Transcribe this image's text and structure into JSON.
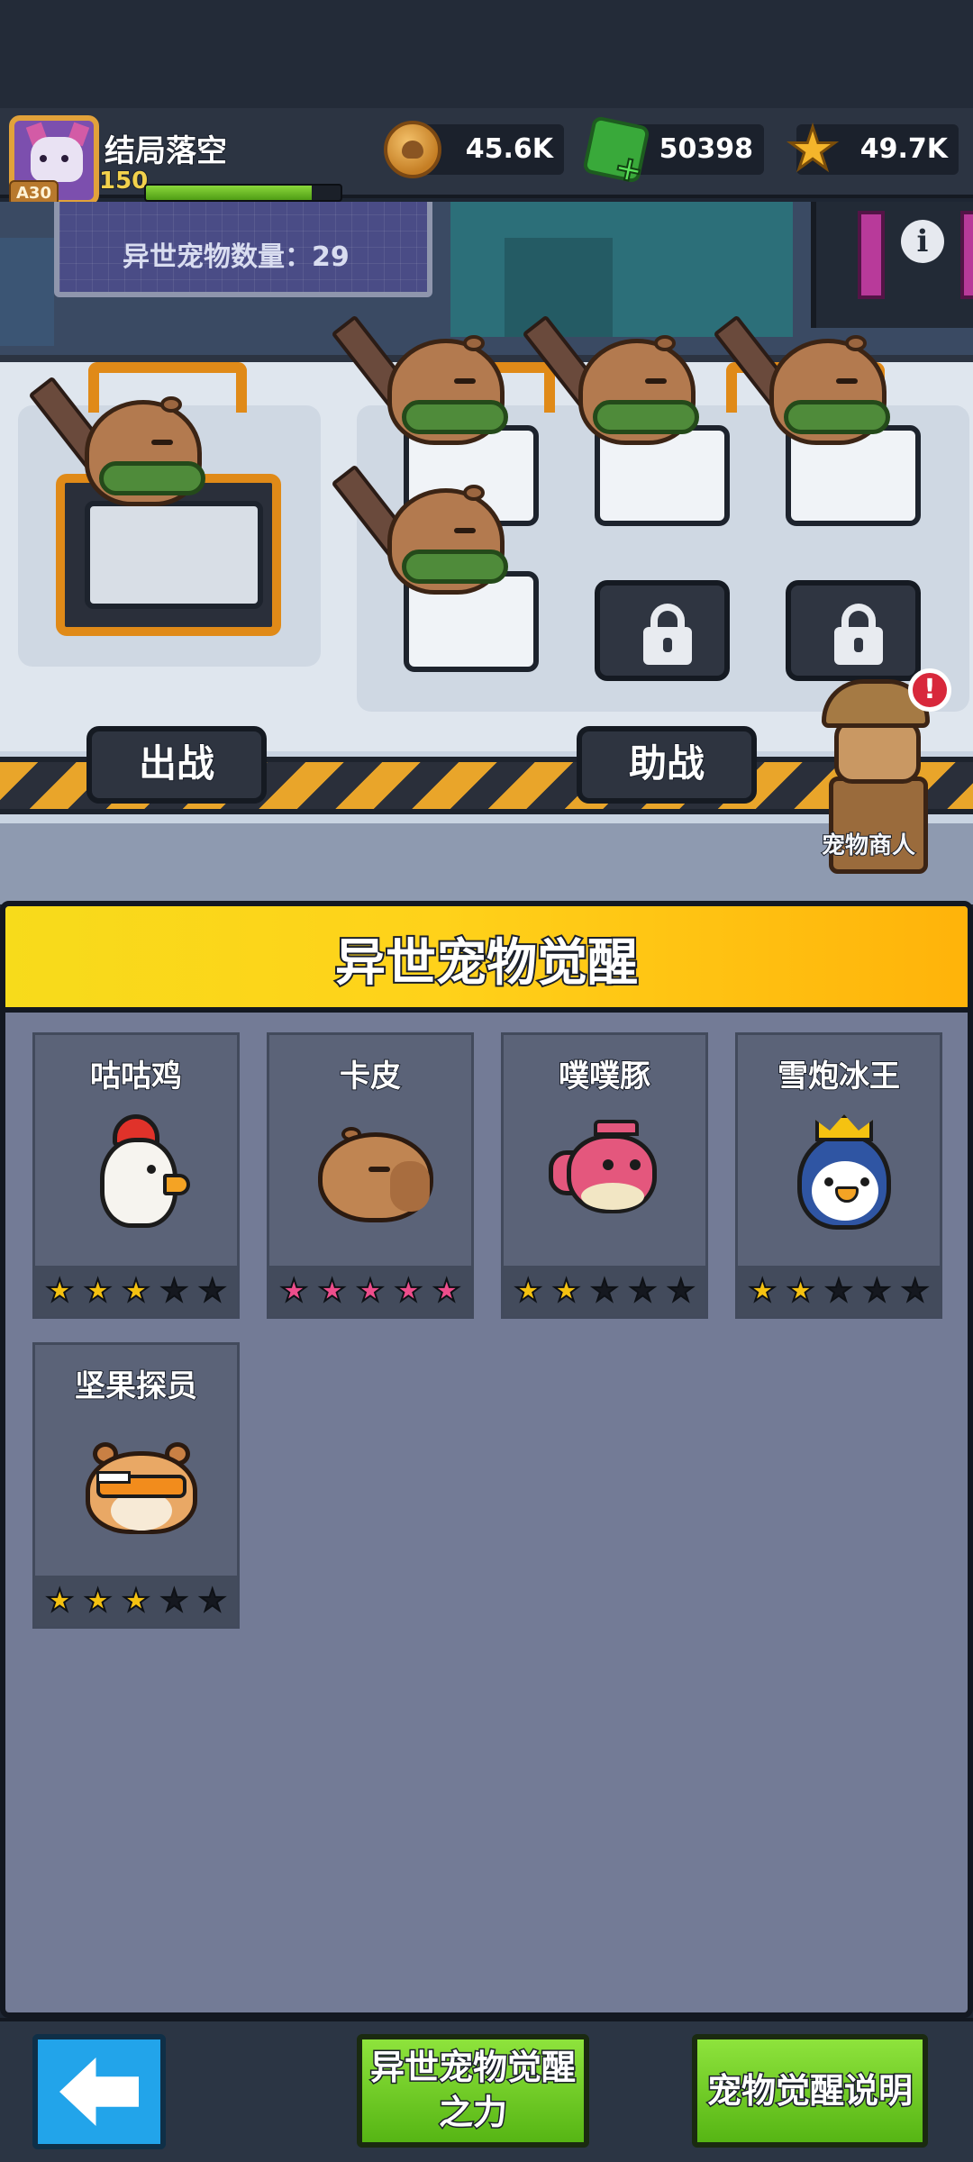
{
  "player": {
    "name": "结局落空",
    "level_badge": "A30",
    "power": "150",
    "xp_fraction": 0.85
  },
  "currencies": {
    "coin": {
      "icon": "coin-icon",
      "value": "45.6K"
    },
    "gem": {
      "icon": "gem-plus-icon",
      "value": "50398"
    },
    "star": {
      "icon": "star-icon",
      "value": "49.7K"
    }
  },
  "scene": {
    "pet_count_label": "异世宠物数量：29",
    "deploy_label": "出战",
    "assist_label": "助战",
    "merchant_label": "宠物商人",
    "merchant_alert": "!",
    "info_icon": "i"
  },
  "modal": {
    "title": "异世宠物觉醒",
    "pets": [
      {
        "name": "咕咕鸡",
        "icon": "chicken-icon",
        "stars": 3,
        "star_color": "gold"
      },
      {
        "name": "卡皮",
        "icon": "capybara-icon",
        "stars": 5,
        "star_color": "pink"
      },
      {
        "name": "噗噗豚",
        "icon": "pufferfish-icon",
        "stars": 2,
        "star_color": "gold"
      },
      {
        "name": "雪炮冰王",
        "icon": "penguin-king-icon",
        "stars": 2,
        "star_color": "gold"
      },
      {
        "name": "坚果探员",
        "icon": "hamster-agent-icon",
        "stars": 3,
        "star_color": "gold"
      }
    ]
  },
  "bottom": {
    "back_icon": "back-arrow-icon",
    "power_label_line1": "异世宠物觉醒",
    "power_label_line2": "之力",
    "explain_label": "宠物觉醒说明"
  },
  "colors": {
    "star_gold": "#f5c211",
    "star_pink": "#ee4e8c",
    "modal_header": "#ffd21a",
    "green_button": "#6fcb24",
    "back_button": "#22a4ea"
  }
}
